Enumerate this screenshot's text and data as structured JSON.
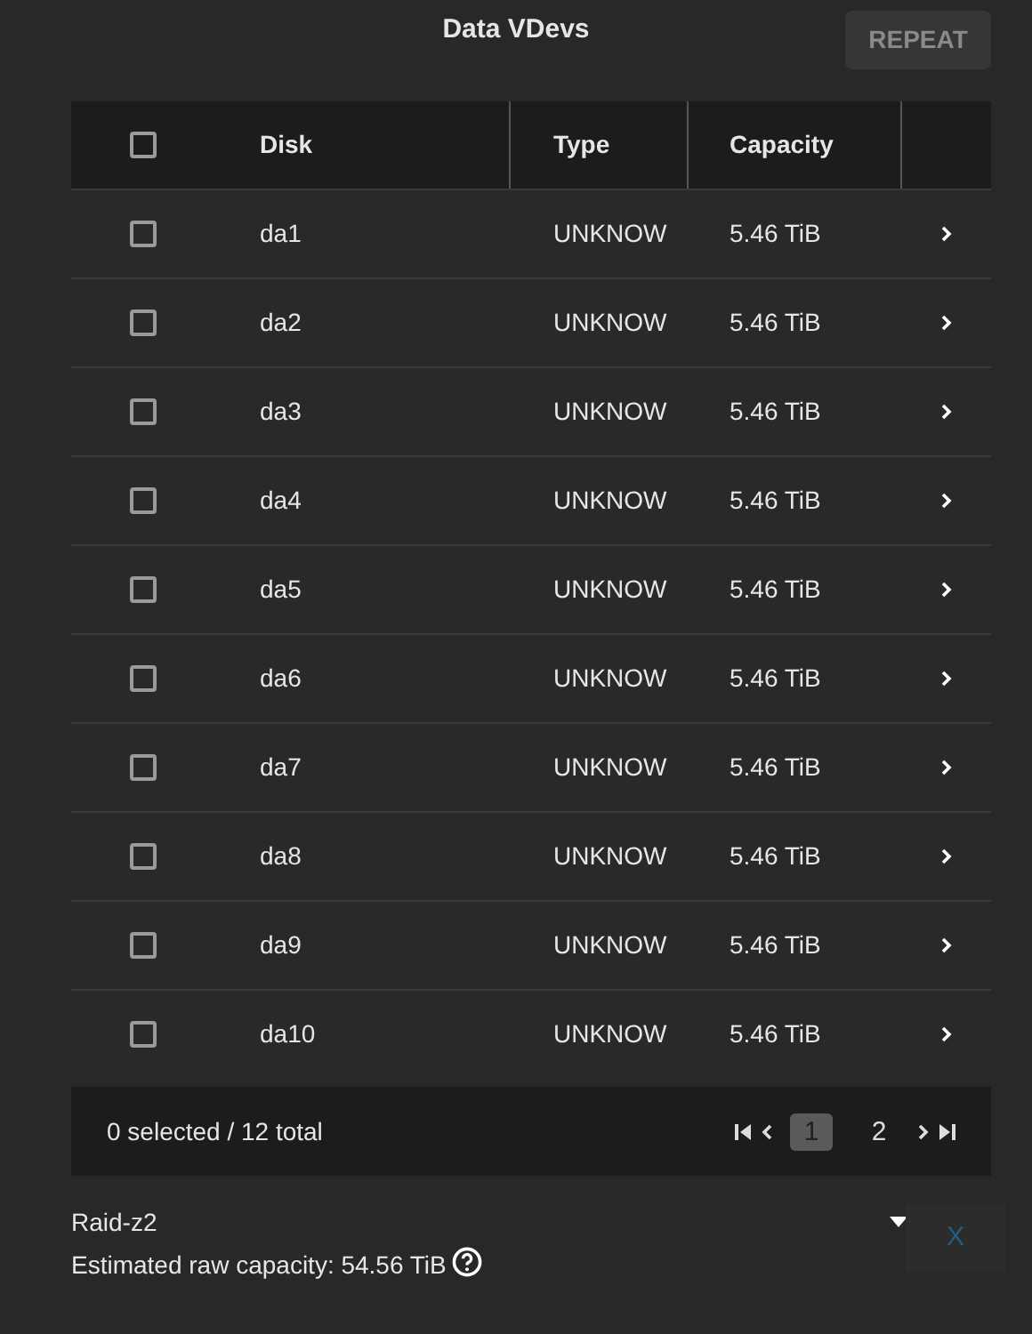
{
  "title": "Data VDevs",
  "repeat_button": {
    "label": "REPEAT",
    "disabled": true
  },
  "table": {
    "select_all": {
      "checked": false
    },
    "columns": [
      "Disk",
      "Type",
      "Capacity"
    ],
    "rows": [
      {
        "disk": "da1",
        "type": "UNKNOW",
        "capacity": "5.46 TiB",
        "checked": false
      },
      {
        "disk": "da2",
        "type": "UNKNOW",
        "capacity": "5.46 TiB",
        "checked": false
      },
      {
        "disk": "da3",
        "type": "UNKNOW",
        "capacity": "5.46 TiB",
        "checked": false
      },
      {
        "disk": "da4",
        "type": "UNKNOW",
        "capacity": "5.46 TiB",
        "checked": false
      },
      {
        "disk": "da5",
        "type": "UNKNOW",
        "capacity": "5.46 TiB",
        "checked": false
      },
      {
        "disk": "da6",
        "type": "UNKNOW",
        "capacity": "5.46 TiB",
        "checked": false
      },
      {
        "disk": "da7",
        "type": "UNKNOW",
        "capacity": "5.46 TiB",
        "checked": false
      },
      {
        "disk": "da8",
        "type": "UNKNOW",
        "capacity": "5.46 TiB",
        "checked": false
      },
      {
        "disk": "da9",
        "type": "UNKNOW",
        "capacity": "5.46 TiB",
        "checked": false
      },
      {
        "disk": "da10",
        "type": "UNKNOW",
        "capacity": "5.46 TiB",
        "checked": false
      }
    ],
    "footer": {
      "summary": "0 selected / 12 total",
      "pages": [
        {
          "label": "1",
          "selected": true
        },
        {
          "label": "2",
          "selected": false
        }
      ]
    }
  },
  "layout_select": {
    "value": "Raid-z2"
  },
  "remove_button": {
    "label": "X"
  },
  "estimate": "Estimated raw capacity: 54.56 TiB"
}
